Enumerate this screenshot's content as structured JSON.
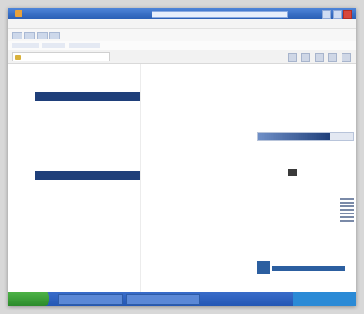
{
  "browser": {
    "title": "",
    "address": "",
    "tab_label": "",
    "menu": [
      "",
      "",
      "",
      "",
      ""
    ]
  },
  "sidebar": {
    "top_note": "",
    "block1_title": "",
    "block1_lines": [
      "",
      "",
      "",
      "",
      ""
    ],
    "block2_title": "",
    "block2_lines": [
      "",
      "",
      "",
      "",
      "",
      "",
      "",
      ""
    ]
  },
  "main": {
    "heading": "",
    "subheading": "",
    "label1": "",
    "label2": "",
    "progress_fraction": 0.75,
    "badge_text": "",
    "qr_caption": "",
    "footer_text": ""
  },
  "taskbar": {
    "start_label": "",
    "clock": ""
  },
  "colors": {
    "accent": "#1f3f7a",
    "heading": "#d4552f",
    "taskbar": "#2457b4"
  }
}
